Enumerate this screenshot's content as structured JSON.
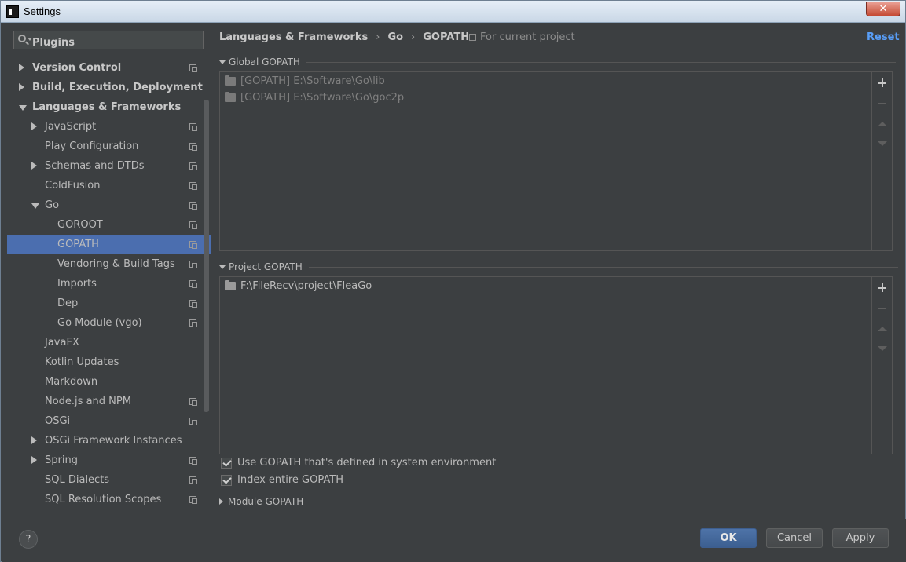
{
  "window": {
    "title": "Settings",
    "close_label": "✕"
  },
  "search": {
    "placeholder": "",
    "value": ""
  },
  "tree": [
    {
      "label": "Plugins",
      "bold": true,
      "level": 0,
      "arrow": "none",
      "icon": false,
      "partial": true
    },
    {
      "label": "Version Control",
      "bold": true,
      "level": 0,
      "arrow": "right",
      "icon": true
    },
    {
      "label": "Build, Execution, Deployment",
      "bold": true,
      "level": 0,
      "arrow": "right",
      "icon": false
    },
    {
      "label": "Languages & Frameworks",
      "bold": true,
      "level": 0,
      "arrow": "down",
      "icon": false
    },
    {
      "label": "JavaScript",
      "bold": false,
      "level": 1,
      "arrow": "right",
      "icon": true
    },
    {
      "label": "Play Configuration",
      "bold": false,
      "level": 1,
      "arrow": "none",
      "icon": true
    },
    {
      "label": "Schemas and DTDs",
      "bold": false,
      "level": 1,
      "arrow": "right",
      "icon": true
    },
    {
      "label": "ColdFusion",
      "bold": false,
      "level": 1,
      "arrow": "none",
      "icon": true
    },
    {
      "label": "Go",
      "bold": false,
      "level": 1,
      "arrow": "down",
      "icon": true
    },
    {
      "label": "GOROOT",
      "bold": false,
      "level": 2,
      "arrow": "none",
      "icon": true
    },
    {
      "label": "GOPATH",
      "bold": false,
      "level": 2,
      "arrow": "none",
      "icon": true,
      "selected": true
    },
    {
      "label": "Vendoring & Build Tags",
      "bold": false,
      "level": 2,
      "arrow": "none",
      "icon": true
    },
    {
      "label": "Imports",
      "bold": false,
      "level": 2,
      "arrow": "none",
      "icon": true
    },
    {
      "label": "Dep",
      "bold": false,
      "level": 2,
      "arrow": "none",
      "icon": true
    },
    {
      "label": "Go Module (vgo)",
      "bold": false,
      "level": 2,
      "arrow": "none",
      "icon": true
    },
    {
      "label": "JavaFX",
      "bold": false,
      "level": 1,
      "arrow": "none",
      "icon": false
    },
    {
      "label": "Kotlin Updates",
      "bold": false,
      "level": 1,
      "arrow": "none",
      "icon": false
    },
    {
      "label": "Markdown",
      "bold": false,
      "level": 1,
      "arrow": "none",
      "icon": false
    },
    {
      "label": "Node.js and NPM",
      "bold": false,
      "level": 1,
      "arrow": "none",
      "icon": true
    },
    {
      "label": "OSGi",
      "bold": false,
      "level": 1,
      "arrow": "none",
      "icon": true
    },
    {
      "label": "OSGi Framework Instances",
      "bold": false,
      "level": 1,
      "arrow": "right",
      "icon": false
    },
    {
      "label": "Spring",
      "bold": false,
      "level": 1,
      "arrow": "right",
      "icon": true
    },
    {
      "label": "SQL Dialects",
      "bold": false,
      "level": 1,
      "arrow": "none",
      "icon": true
    },
    {
      "label": "SQL Resolution Scopes",
      "bold": false,
      "level": 1,
      "arrow": "none",
      "icon": true
    }
  ],
  "breadcrumb": {
    "items": [
      "Languages & Frameworks",
      "Go",
      "GOPATH"
    ],
    "separator": "›"
  },
  "scope_label": "For current project",
  "reset_label": "Reset",
  "global_gopath": {
    "title": "Global GOPATH",
    "paths": [
      "[GOPATH] E:\\Software\\Go\\lib",
      "[GOPATH] E:\\Software\\Go\\goc2p"
    ]
  },
  "project_gopath": {
    "title": "Project GOPATH",
    "paths": [
      "F:\\FileRecv\\project\\FleaGo"
    ]
  },
  "options": {
    "use_system_gopath": {
      "label": "Use GOPATH that's defined in system environment",
      "checked": true
    },
    "index_entire_gopath": {
      "label": "Index entire GOPATH",
      "checked": true
    }
  },
  "module_gopath": {
    "title": "Module GOPATH"
  },
  "buttons": {
    "help": "?",
    "ok": "OK",
    "cancel": "Cancel",
    "apply": "Apply"
  },
  "colors": {
    "background": "#3c3f41",
    "selection": "#4b6eaf",
    "link": "#589df6",
    "default_button": "#4e73a8"
  }
}
